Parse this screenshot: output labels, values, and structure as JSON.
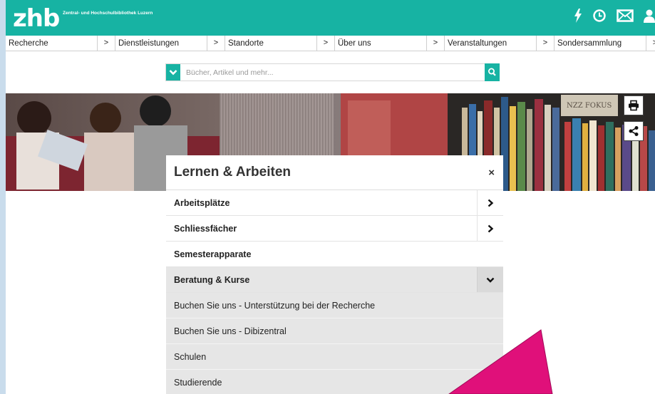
{
  "brand": {
    "logo": "zhb",
    "tagline": "Zentral- und Hochschulbibliothek Luzern",
    "color": "#17b3a3"
  },
  "top_icons": [
    "lightning-icon",
    "clock-icon",
    "mail-icon",
    "user-icon"
  ],
  "nav": {
    "items": [
      {
        "label": "Recherche",
        "arrow": ">"
      },
      {
        "label": "Dienstleistungen",
        "arrow": ">"
      },
      {
        "label": "Standorte",
        "arrow": ">"
      },
      {
        "label": "Über uns",
        "arrow": ">"
      },
      {
        "label": "Veranstaltungen",
        "arrow": ">"
      },
      {
        "label": "Sondersammlung",
        "arrow": ">"
      }
    ]
  },
  "search": {
    "placeholder": "Bücher, Artikel und mehr..."
  },
  "hero": {
    "book_title": "NZZ FOKUS"
  },
  "panel": {
    "title": "Lernen & Arbeiten",
    "close": "×",
    "items": [
      {
        "label": "Arbeitsplätze",
        "chevron": "right"
      },
      {
        "label": "Schliessfächer",
        "chevron": "right"
      },
      {
        "label": "Semesterapparate",
        "chevron": "none"
      },
      {
        "label": "Beratung & Kurse",
        "chevron": "down"
      }
    ],
    "subitems": [
      {
        "label": "Buchen Sie uns - Unterstützung bei der Recherche"
      },
      {
        "label": "Buchen Sie uns - Dibizentral"
      },
      {
        "label": "Schulen"
      },
      {
        "label": "Studierende"
      }
    ]
  },
  "annotation": {
    "arrow_color": "#e0107a"
  }
}
